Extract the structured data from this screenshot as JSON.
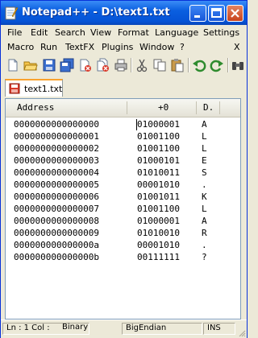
{
  "window": {
    "title": "Notepad++ - D:\\text1.txt"
  },
  "menu_row1": [
    "File",
    "Edit",
    "Search",
    "View",
    "Format",
    "Language",
    "Settings"
  ],
  "menu_row2": [
    "Macro",
    "Run",
    "TextFX",
    "Plugins",
    "Window",
    "?"
  ],
  "menu_close": "X",
  "toolbar": [
    "new-file-icon",
    "open-folder-icon",
    "save-icon",
    "save-all-icon",
    "close-file-icon",
    "close-all-icon",
    "print-icon",
    "cut-icon",
    "copy-icon",
    "paste-icon",
    "undo-icon",
    "redo-icon",
    "binoculars-icon"
  ],
  "tab": {
    "label": "text1.txt"
  },
  "hex_view": {
    "headers": {
      "address": "Address",
      "offset": "+0",
      "dump": "D."
    },
    "rows": [
      {
        "address": "0000000000000000",
        "bin": "01000001",
        "chr": "A"
      },
      {
        "address": "0000000000000001",
        "bin": "01001100",
        "chr": "L"
      },
      {
        "address": "0000000000000002",
        "bin": "01001100",
        "chr": "L"
      },
      {
        "address": "0000000000000003",
        "bin": "01000101",
        "chr": "E"
      },
      {
        "address": "0000000000000004",
        "bin": "01010011",
        "chr": "S"
      },
      {
        "address": "0000000000000005",
        "bin": "00001010",
        "chr": "."
      },
      {
        "address": "0000000000000006",
        "bin": "01001011",
        "chr": "K"
      },
      {
        "address": "0000000000000007",
        "bin": "01001100",
        "chr": "L"
      },
      {
        "address": "0000000000000008",
        "bin": "01000001",
        "chr": "A"
      },
      {
        "address": "0000000000000009",
        "bin": "01010010",
        "chr": "R"
      },
      {
        "address": "000000000000000a",
        "bin": "00001010",
        "chr": "."
      },
      {
        "address": "000000000000000b",
        "bin": "00111111",
        "chr": "?"
      }
    ]
  },
  "status": {
    "position": "Ln : 1   Col :",
    "mode": "Binary",
    "endian": "BigEndian",
    "insert": "INS"
  },
  "colors": {
    "titlebar": "#0a5fe0",
    "tab_accent": "#f9a22e"
  }
}
